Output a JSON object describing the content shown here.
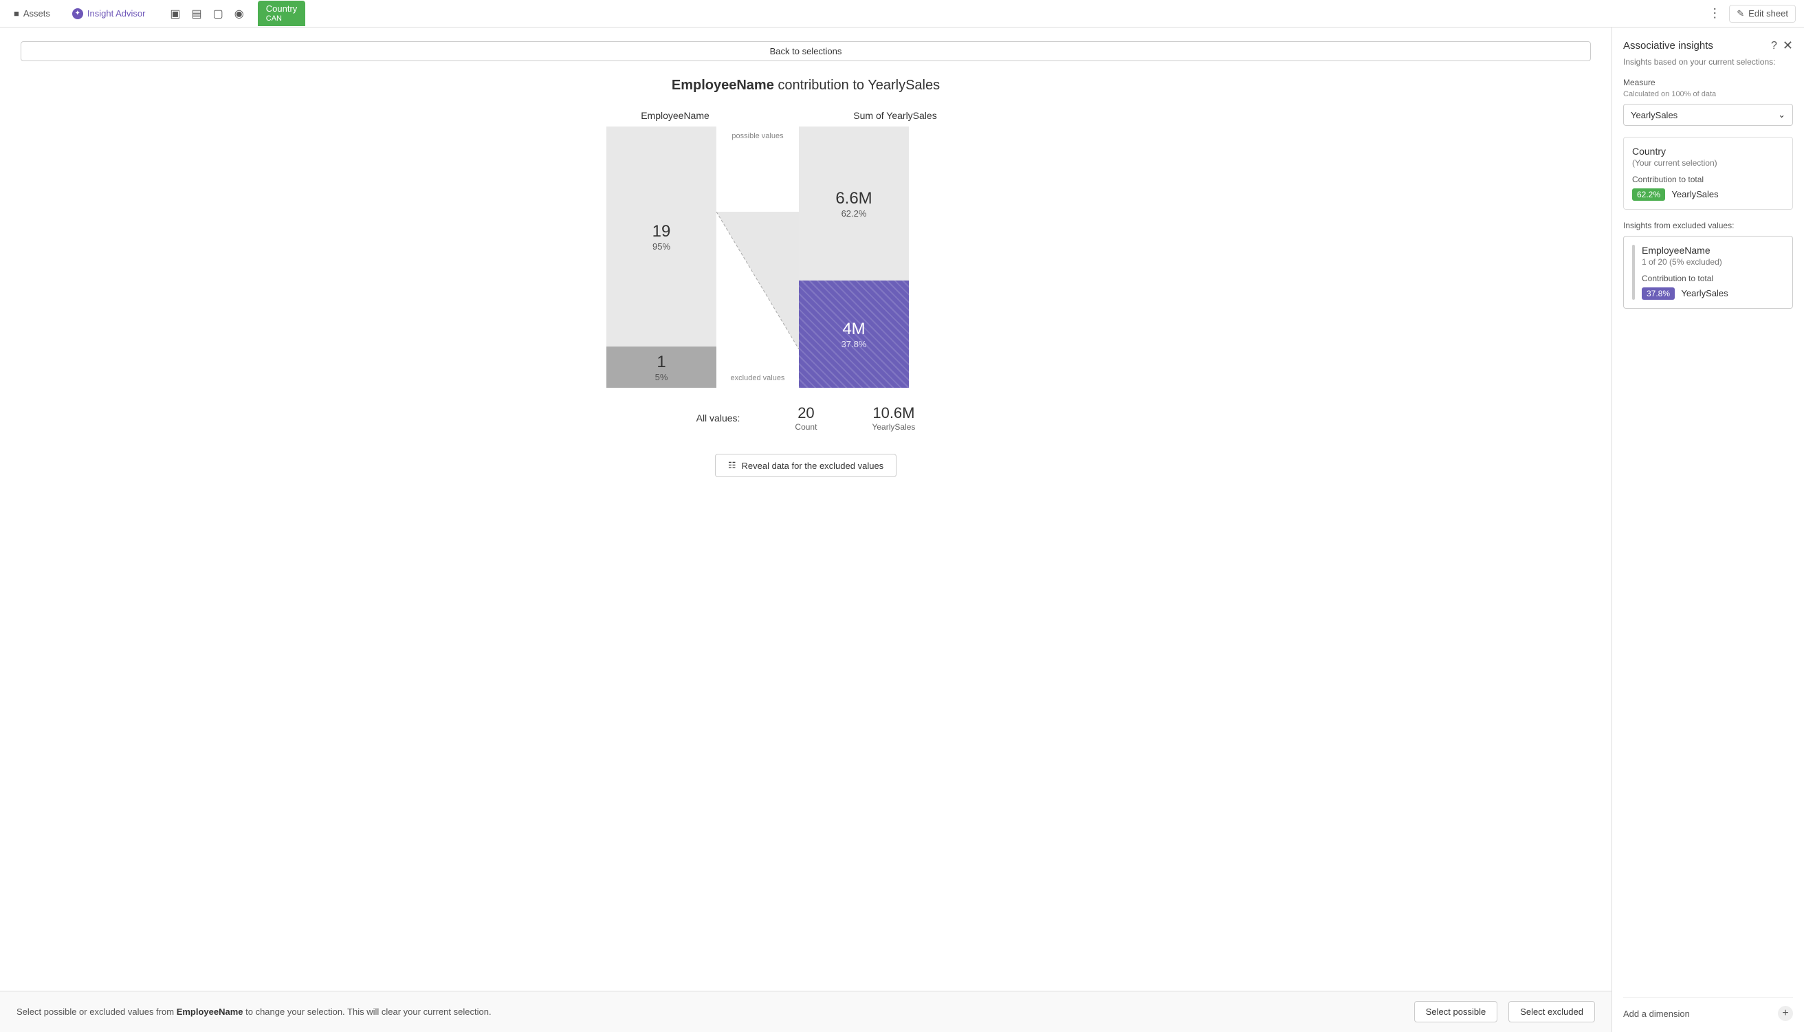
{
  "appbar": {
    "assets_label": "Assets",
    "insight_advisor_label": "Insight Advisor",
    "country_tab_label": "Country",
    "country_tab_sub": "CAN",
    "edit_sheet_label": "Edit sheet"
  },
  "back_btn": "Back to selections",
  "chart_title": {
    "dimension": "EmployeeName",
    "connector": " contribution to ",
    "measure": "YearlySales"
  },
  "columns": {
    "employee_header": "EmployeeName",
    "sales_header": "Sum of YearlySales"
  },
  "bars": {
    "possible_label": "possible values",
    "excluded_label": "excluded values",
    "possible_count": "19",
    "possible_pct": "95%",
    "excluded_count": "1",
    "excluded_pct": "5%",
    "sales_possible_value": "6.6M",
    "sales_possible_pct": "62.2%",
    "sales_excluded_value": "4M",
    "sales_excluded_pct": "37.8%"
  },
  "all_values": {
    "label": "All values:",
    "count": "20",
    "count_sub": "Count",
    "sales": "10.6M",
    "sales_sub": "YearlySales"
  },
  "reveal_btn": "Reveal data for the excluded values",
  "bottom_bar": {
    "text_prefix": "Select possible or excluded values from ",
    "dimension": "EmployeeName",
    "text_suffix": " to change your selection. This will clear your current selection.",
    "select_possible": "Select possible",
    "select_excluded": "Select excluded"
  },
  "sidebar": {
    "title": "Associative insights",
    "subtitle": "Insights based on your current selections:",
    "measure_label": "Measure",
    "measure_sublabel": "Calculated on 100% of data",
    "measure_value": "YearlySales",
    "country_card": {
      "title": "Country",
      "subtitle": "(Your current selection)",
      "contrib_label": "Contribution to total",
      "badge": "62.2%",
      "measure": "YearlySales"
    },
    "excluded_header": "Insights from excluded values:",
    "employee_card": {
      "title": "EmployeeName",
      "subtitle": "1 of 20 (5% excluded)",
      "contrib_label": "Contribution to total",
      "badge": "37.8%",
      "measure": "YearlySales"
    },
    "add_dimension": "Add a dimension"
  }
}
